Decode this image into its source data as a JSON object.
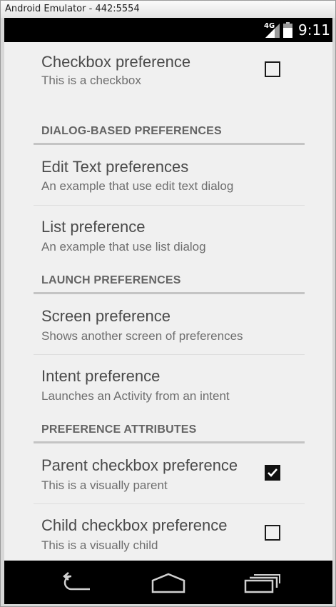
{
  "window": {
    "title": "Android Emulator - 442:5554"
  },
  "status_bar": {
    "network": "4G",
    "time": "9:11"
  },
  "preferences": {
    "checkbox_pref": {
      "title": "Checkbox preference",
      "summary": "This is a checkbox",
      "checked": false
    },
    "dialog_category": "DIALOG-BASED PREFERENCES",
    "edit_text_pref": {
      "title": "Edit Text preferences",
      "summary": "An example that use edit text dialog"
    },
    "list_pref": {
      "title": "List preference",
      "summary": "An example that use list dialog"
    },
    "launch_category": "LAUNCH PREFERENCES",
    "screen_pref": {
      "title": "Screen preference",
      "summary": "Shows another screen of preferences"
    },
    "intent_pref": {
      "title": "Intent preference",
      "summary": "Launches an Activity from an intent"
    },
    "attributes_category": "PREFERENCE ATTRIBUTES",
    "parent_checkbox_pref": {
      "title": "Parent checkbox preference",
      "summary": "This is a visually parent",
      "checked": true
    },
    "child_checkbox_pref": {
      "title": "Child checkbox preference",
      "summary": "This is a visually child",
      "checked": false
    }
  },
  "nav_bar": {
    "icons": [
      "back-icon",
      "home-icon",
      "recent-apps-icon"
    ]
  },
  "colors": {
    "status_bar": "#000000",
    "content_bg": "#f0f0f0",
    "title_text": "#4a4a4a",
    "summary_text": "#6e6e6e",
    "category_text": "#646464"
  }
}
